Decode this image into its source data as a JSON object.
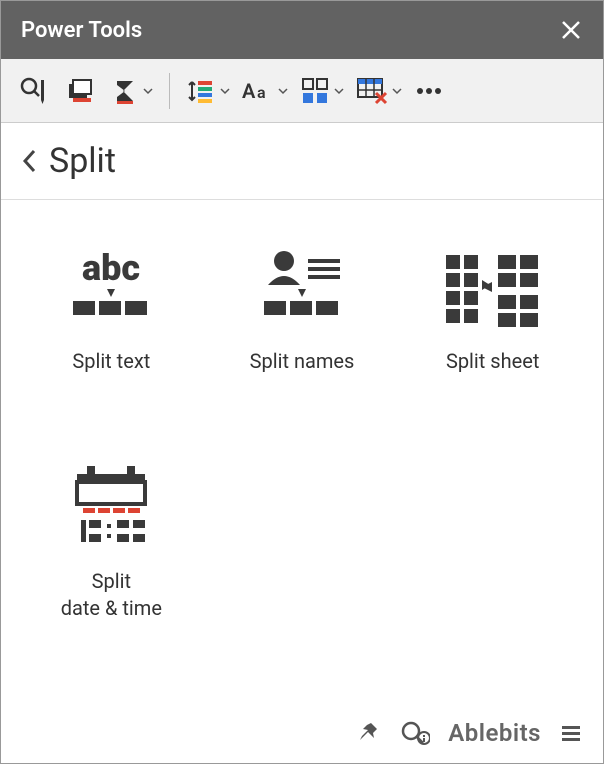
{
  "titlebar": {
    "title": "Power Tools"
  },
  "breadcrumb": {
    "label": "Split"
  },
  "tiles": {
    "split_text": "Split text",
    "split_names": "Split names",
    "split_sheet": "Split sheet",
    "split_date_time": "Split\ndate & time"
  },
  "footer": {
    "brand": "Ablebits"
  }
}
